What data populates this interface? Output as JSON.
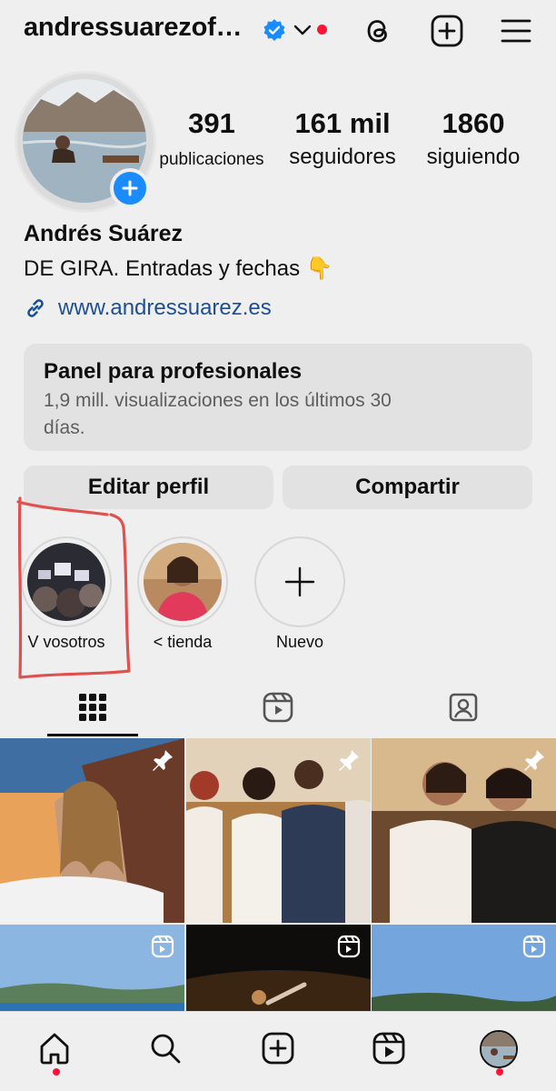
{
  "header": {
    "username": "andressuarezof…",
    "icons": [
      "verified-icon",
      "chevron-down-icon",
      "threads-icon",
      "add-post-icon",
      "menu-icon"
    ],
    "accent_red": "#ff1438"
  },
  "profile": {
    "stats": [
      {
        "value": "391",
        "label": "publicaciones"
      },
      {
        "value": "161 mil",
        "label": "seguidores"
      },
      {
        "value": "1860",
        "label": "siguiendo"
      }
    ],
    "full_name": "Andrés Suárez",
    "bio": "DE GIRA. Entradas y fechas",
    "bio_emoji": "👇",
    "link": "www.andressuarez.es",
    "link_color": "#1d4f91"
  },
  "panel": {
    "title": "Panel para profesionales",
    "subtitle_line1": "1,9 mill. visualizaciones en los últimos 30",
    "subtitle_line2": "días."
  },
  "buttons": {
    "edit": "Editar perfil",
    "share": "Compartir"
  },
  "highlights": [
    {
      "label": "V vosotros"
    },
    {
      "label": "< tienda"
    },
    {
      "label": "Nuevo"
    }
  ],
  "tabs": [
    "grid-icon",
    "reels-icon",
    "tagged-icon"
  ],
  "grid_badges": [
    "pin-icon",
    "pin-icon",
    "pin-icon",
    "reel-icon",
    "reel-icon",
    "reel-icon"
  ],
  "bottom_nav": [
    "home-icon",
    "search-icon",
    "create-icon",
    "reels-icon",
    "profile-avatar"
  ],
  "brand_blue": "#1a8cff"
}
